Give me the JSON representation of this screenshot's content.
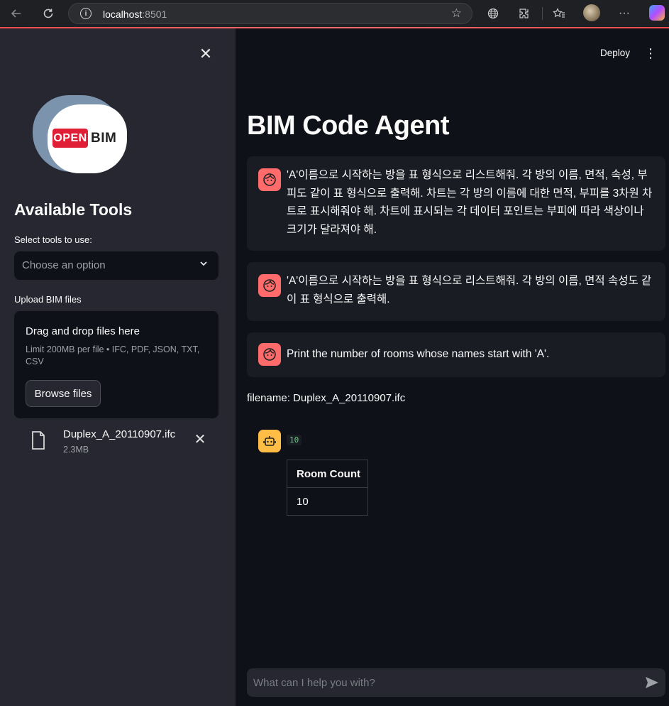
{
  "browser": {
    "url_host": "localhost",
    "url_port": ":8501"
  },
  "sidebar": {
    "logo_open": "OPEN",
    "logo_bim": "BIM",
    "title": "Available Tools",
    "select_label": "Select tools to use:",
    "select_placeholder": "Choose an option",
    "upload_label": "Upload BIM files",
    "dropzone_title": "Drag and drop files here",
    "dropzone_limit": "Limit 200MB per file • IFC, PDF, JSON, TXT, CSV",
    "browse_label": "Browse files",
    "uploaded_file": {
      "name": "Duplex_A_20110907.ifc",
      "size": "2.3MB"
    }
  },
  "header": {
    "deploy_label": "Deploy"
  },
  "main": {
    "title": "BIM Code Agent",
    "messages": [
      {
        "role": "user",
        "text": "'A'이름으로 시작하는 방을 표 형식으로 리스트해줘. 각 방의 이름, 면적, 속성, 부피도 같이 표 형식으로 출력해. 차트는 각 방의 이름에 대한 면적, 부피를 3차원 차트로 표시해줘야 해. 차트에 표시되는 각 데이터 포인트는 부피에 따라 색상이나 크기가 달라져야 해."
      },
      {
        "role": "user",
        "text": "'A'이름으로 시작하는 방을 표 형식으로 리스트해줘. 각 방의 이름, 면적 속성도 같이 표 형식으로 출력해."
      },
      {
        "role": "user",
        "text": "Print the number of rooms whose names start with 'A'."
      }
    ],
    "filename_line": "filename: Duplex_A_20110907.ifc",
    "bot_response": {
      "code_output": "10",
      "table": {
        "headers": [
          "Room Count"
        ],
        "rows": [
          [
            "10"
          ]
        ]
      }
    },
    "chat_placeholder": "What can I help you with?"
  },
  "colors": {
    "user_avatar": "#ff6b6b",
    "bot_avatar": "#ffbd45",
    "accent": "#ff4b4b"
  }
}
